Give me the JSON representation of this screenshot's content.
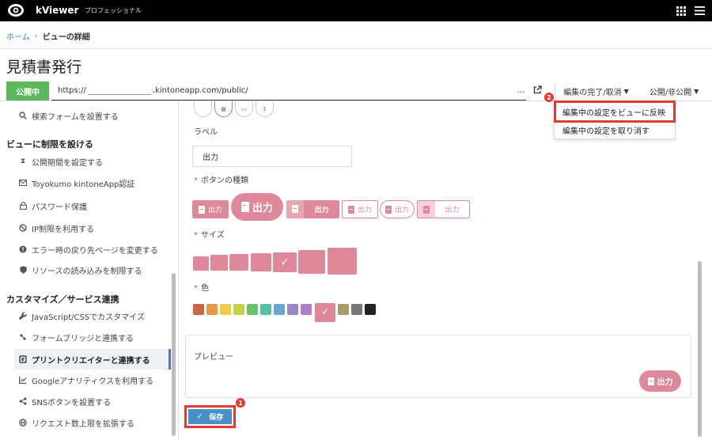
{
  "app": {
    "name": "kViewer",
    "edition": "プロフェッショナル"
  },
  "breadcrumb": {
    "home": "ホーム",
    "current": "ビューの詳細"
  },
  "page": {
    "title": "見積書発行"
  },
  "status": {
    "badge": "公開中",
    "url_prefix": "https://",
    "url_suffix": ".kintoneapp.com/public/",
    "url_ellipsis": "...",
    "edit_menu": "編集の完了/取消",
    "public_menu": "公開/非公開"
  },
  "dropdown": {
    "items": [
      "編集中の設定をビューに反映",
      "編集中の設定を取り消す"
    ],
    "badge": "2"
  },
  "sidebar": {
    "item_search_form": "検索フォームを設置する",
    "section_restrict": "ビューに制限を設ける",
    "item_period": "公開期間を設定する",
    "item_auth": "Toyokumo kintoneApp認証",
    "item_password": "パスワード保護",
    "item_ip": "IP制限を利用する",
    "item_error": "エラー時の戻り先ページを変更する",
    "item_resource": "リソースの読み込みを制限する",
    "section_custom": "カスタマイズ／サービス連携",
    "item_js": "JavaScript/CSSでカスタマイズ",
    "item_formbridge": "フォームブリッジと連携する",
    "item_printcreator": "プリントクリエイターと連携する",
    "item_ga": "Googleアナリティクスを利用する",
    "item_sns": "SNSボタンを設置する",
    "item_request": "リクエスト数上限を拡張する"
  },
  "form": {
    "label_title": "ラベル",
    "label_value": "出力",
    "required": "*",
    "button_type_title": "ボタンの種類",
    "size_title": "サイズ",
    "color_title": "色",
    "button_type_options": [
      "出力",
      "出力",
      "出力",
      "出力",
      "出力",
      "出力"
    ],
    "selected_button_type": 2,
    "sizes_count_label": "",
    "selected_size": 5,
    "colors": [
      "#c8674a",
      "#e49a45",
      "#f2cb4c",
      "#c2d34b",
      "#6ec26d",
      "#57c1a3",
      "#6aa6d4",
      "#9a86c4",
      "#b07ec1",
      "#de8899",
      "#a89a6c",
      "#787878",
      "#222222"
    ],
    "selected_color": 9
  },
  "preview": {
    "title": "プレビュー",
    "button_label": "出力"
  },
  "save": {
    "label": "保存",
    "badge": "1"
  },
  "colors": {
    "accent": "#de8899",
    "highlight": "#e33b2e",
    "public_green": "#5cb85c",
    "save_blue": "#4a90c8"
  }
}
